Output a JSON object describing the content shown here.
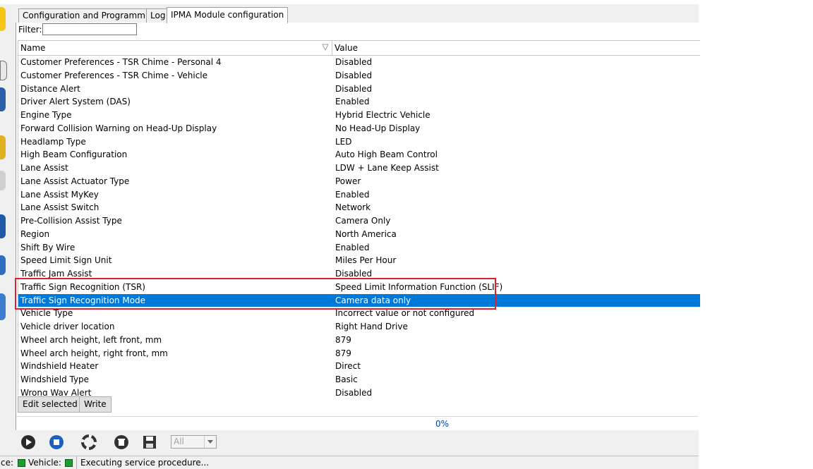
{
  "tabs": [
    {
      "label": "Configuration and Programming"
    },
    {
      "label": "Log"
    },
    {
      "label": "IPMA Module configuration"
    }
  ],
  "filter": {
    "label": "Filter:",
    "value": ""
  },
  "table": {
    "columns": [
      "Name",
      "Value"
    ],
    "rows": [
      {
        "name": "Customer Preferences - TSR Chime - Personal 4",
        "value": "Disabled"
      },
      {
        "name": "Customer Preferences - TSR Chime - Vehicle",
        "value": "Disabled"
      },
      {
        "name": "Distance Alert",
        "value": "Disabled"
      },
      {
        "name": "Driver Alert System (DAS)",
        "value": "Enabled"
      },
      {
        "name": "Engine Type",
        "value": "Hybrid Electric Vehicle"
      },
      {
        "name": "Forward Collision Warning on Head-Up Display",
        "value": "No Head-Up Display"
      },
      {
        "name": "Headlamp Type",
        "value": "LED"
      },
      {
        "name": "High Beam Configuration",
        "value": "Auto High Beam Control"
      },
      {
        "name": "Lane Assist",
        "value": "LDW + Lane Keep Assist"
      },
      {
        "name": "Lane Assist Actuator Type",
        "value": "Power"
      },
      {
        "name": "Lane Assist MyKey",
        "value": "Enabled"
      },
      {
        "name": "Lane Assist Switch",
        "value": "Network"
      },
      {
        "name": "Pre-Collision Assist Type",
        "value": "Camera Only"
      },
      {
        "name": "Region",
        "value": "North America"
      },
      {
        "name": "Shift By Wire",
        "value": "Enabled"
      },
      {
        "name": "Speed Limit Sign Unit",
        "value": "Miles Per Hour"
      },
      {
        "name": "Traffic Jam Assist",
        "value": "Disabled"
      },
      {
        "name": "Traffic Sign Recognition (TSR)",
        "value": "Speed Limit Information Function (SLIF)"
      },
      {
        "name": "Traffic Sign Recognition Mode",
        "value": "Camera data only",
        "selected": true
      },
      {
        "name": "Vehicle Type",
        "value": "Incorrect value or not configured"
      },
      {
        "name": "Vehicle driver location",
        "value": "Right Hand Drive"
      },
      {
        "name": "Wheel arch height, left front, mm",
        "value": "879"
      },
      {
        "name": "Wheel arch height, right front, mm",
        "value": "879"
      },
      {
        "name": "Windshield Heater",
        "value": "Direct"
      },
      {
        "name": "Windshield Type",
        "value": "Basic"
      },
      {
        "name": "Wrong Way Alert",
        "value": "Disabled"
      }
    ]
  },
  "buttons": {
    "edit_selected": "Edit selected",
    "write": "Write"
  },
  "progress": {
    "percent": "0%"
  },
  "toolbar": {
    "icons": [
      "play-icon",
      "stop-icon",
      "lifebuoy-icon",
      "trash-icon",
      "save-icon"
    ],
    "combo_value": "All"
  },
  "status": {
    "left_label": "ce:",
    "vehicle_label": "Vehicle:",
    "message": "Executing service procedure..."
  },
  "colors": {
    "selection": "#0078d7",
    "highlight_box": "#e02030",
    "status_ok": "#1a9f2c",
    "percent_text": "#0044aa"
  }
}
